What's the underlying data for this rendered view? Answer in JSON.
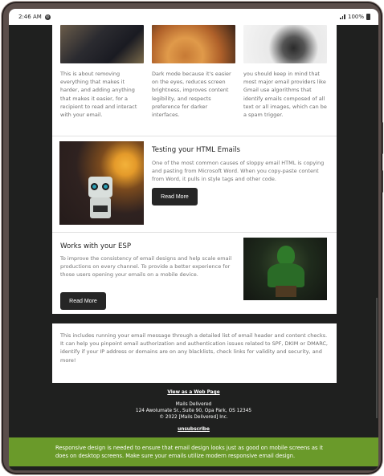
{
  "status_bar": {
    "time": "2:46 AM",
    "battery": "100%"
  },
  "top_columns": [
    {
      "text": "This is about removing everything that makes it harder, and adding anything that makes it easier, for a recipient to read and interact with your email."
    },
    {
      "text": "Dark mode because it's easier on the eyes, reduces screen brightness, improves content legibility, and respects preference for darker interfaces."
    },
    {
      "text": "you should keep in mind that most major email providers like Gmail use algorithms that identify emails composed of all text or all images, which can be a spam trigger."
    }
  ],
  "articles": [
    {
      "title": "Testing your HTML Emails",
      "text": "One of the most common causes of sloppy email HTML is copying and pasting from Microsoft Word. When you copy-paste content from Word, it pulls in style tags and other code.",
      "button": "Read More"
    },
    {
      "title": "Works with your ESP",
      "text": "To improve the consistency of email designs and help scale email productions on every channel. To provide a better experience for those users opening your emails on a mobile device.",
      "button": "Read More"
    }
  ],
  "about": {
    "text": "This includes running your email message through a detailed list of email header and content checks. It can help you pinpoint email authorization and authentication issues related to SPF, DKIM or DMARC, identify if your IP address or domains are on any blacklists, check links for validity and security, and more!"
  },
  "footer": {
    "web_link": "View as a Web Page",
    "company": "Mails Delivered",
    "address": "124 Awolumate Sr., Suite 90, Opa Park, OS 12345",
    "copyright": "© 2022 [Mails Delivered] Inc.",
    "unsubscribe": "unsubscribe"
  },
  "banner": {
    "text": "Responsive design is needed to ensure that email design looks just as good on mobile screens as it does on desktop screens. Make sure your emails utilize modern responsive email design."
  },
  "colors": {
    "background": "#1f201f",
    "banner": "#6a9a2a",
    "button": "#262626"
  }
}
